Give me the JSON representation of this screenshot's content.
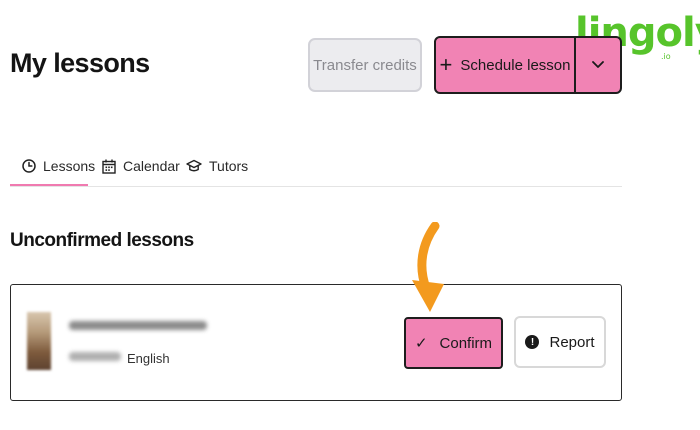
{
  "header": {
    "title": "My lessons",
    "transfer_label": "Transfer credits",
    "schedule_label": "Schedule lesson",
    "schedule_plus": "+"
  },
  "logo": {
    "text": "lingoly",
    "tld": ".io"
  },
  "tabs": [
    {
      "label": "Lessons",
      "icon": "clock-icon",
      "active": true
    },
    {
      "label": "Calendar",
      "icon": "calendar-icon",
      "active": false
    },
    {
      "label": "Tutors",
      "icon": "graduation-cap-icon",
      "active": false
    }
  ],
  "section": {
    "title": "Unconfirmed lessons"
  },
  "lesson": {
    "language": "English",
    "confirm_label": "Confirm",
    "confirm_check": "✓",
    "report_label": "Report",
    "report_icon_glyph": "!"
  },
  "colors": {
    "accent_pink": "#f183b4",
    "tab_underline": "#f07ab0",
    "arrow_orange": "#f39a1e",
    "logo_green": "#57c42b"
  }
}
